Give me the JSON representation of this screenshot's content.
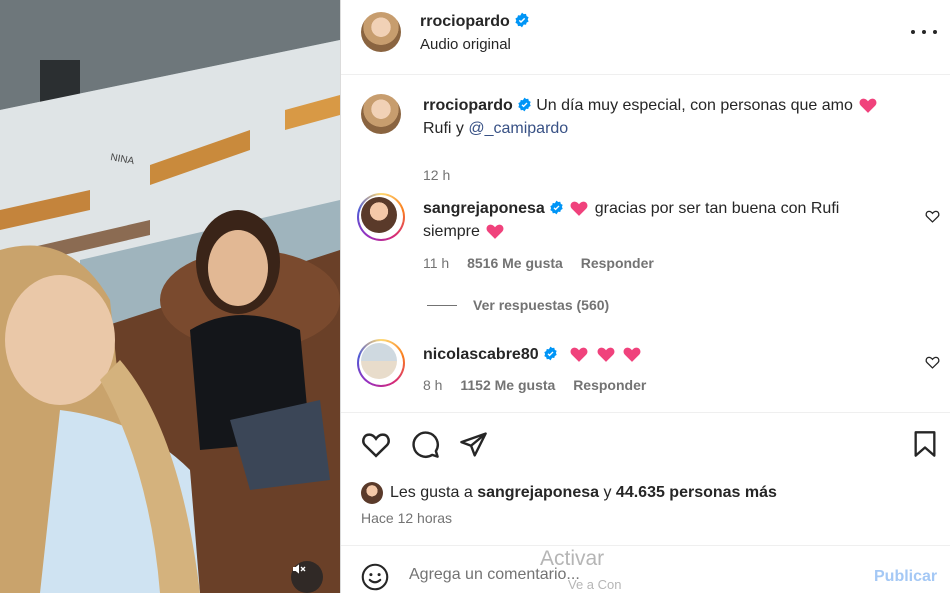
{
  "post": {
    "author": "rrociopardo",
    "audio": "Audio original",
    "caption_user": "rrociopardo",
    "caption_text": "Un día muy especial, con personas que amo",
    "caption_cont": "Rufi y",
    "caption_mention": "@_camipardo",
    "caption_time": "12 h"
  },
  "comments": [
    {
      "user": "sangrejaponesa",
      "text": "gracias por ser tan buena con Rufi",
      "text_cont": "siempre",
      "time": "11 h",
      "likes": "8516 Me gusta",
      "reply": "Responder",
      "view_replies": "Ver respuestas (560)"
    },
    {
      "user": "nicolascabre80",
      "time": "8 h",
      "likes": "1152 Me gusta",
      "reply": "Responder"
    }
  ],
  "likes": {
    "prefix": "Les gusta a",
    "user": "sangrejaponesa",
    "joiner": "y",
    "others": "44.635 personas más"
  },
  "posted_ago": "Hace 12 horas",
  "comment_box": {
    "placeholder": "Agrega un comentario...",
    "publish": "Publicar"
  },
  "watermark": {
    "line1": "Activar",
    "line2": "Ve a Con"
  },
  "colors": {
    "verified": "#0095f6",
    "heart_emoji": "#f0427c",
    "mention": "#385185"
  }
}
